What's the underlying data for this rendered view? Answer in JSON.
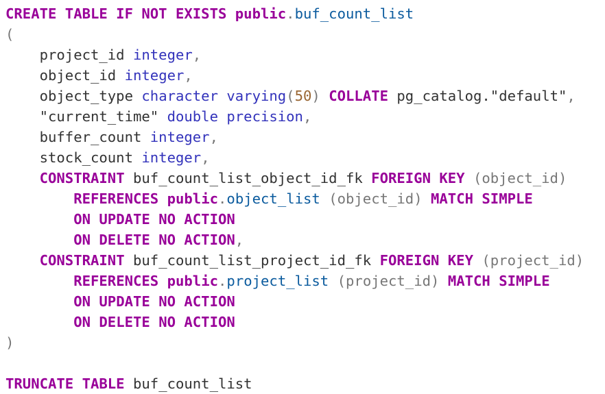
{
  "editor": {
    "lines": [
      [
        {
          "t": "CREATE TABLE IF NOT EXISTS ",
          "c": "kw"
        },
        {
          "t": "public",
          "c": "kw"
        },
        {
          "t": ".",
          "c": "punc"
        },
        {
          "t": "buf_count_list",
          "c": "obj"
        }
      ],
      [
        {
          "t": "(",
          "c": "punc"
        }
      ],
      [
        {
          "t": "    project_id ",
          "c": "id"
        },
        {
          "t": "integer",
          "c": "type"
        },
        {
          "t": ",",
          "c": "punc"
        }
      ],
      [
        {
          "t": "    object_id ",
          "c": "id"
        },
        {
          "t": "integer",
          "c": "type"
        },
        {
          "t": ",",
          "c": "punc"
        }
      ],
      [
        {
          "t": "    object_type ",
          "c": "id"
        },
        {
          "t": "character varying",
          "c": "type"
        },
        {
          "t": "(",
          "c": "punc"
        },
        {
          "t": "50",
          "c": "num"
        },
        {
          "t": ") ",
          "c": "punc"
        },
        {
          "t": "COLLATE",
          "c": "kw"
        },
        {
          "t": " pg_catalog.",
          "c": "id"
        },
        {
          "t": "\"default\"",
          "c": "str"
        },
        {
          "t": ",",
          "c": "punc"
        }
      ],
      [
        {
          "t": "    \"current_time\" ",
          "c": "str"
        },
        {
          "t": "double precision",
          "c": "type"
        },
        {
          "t": ",",
          "c": "punc"
        }
      ],
      [
        {
          "t": "    buffer_count ",
          "c": "id"
        },
        {
          "t": "integer",
          "c": "type"
        },
        {
          "t": ",",
          "c": "punc"
        }
      ],
      [
        {
          "t": "    stock_count ",
          "c": "id"
        },
        {
          "t": "integer",
          "c": "type"
        },
        {
          "t": ",",
          "c": "punc"
        }
      ],
      [
        {
          "t": "    ",
          "c": "id"
        },
        {
          "t": "CONSTRAINT",
          "c": "kw"
        },
        {
          "t": " buf_count_list_object_id_fk ",
          "c": "id"
        },
        {
          "t": "FOREIGN KEY",
          "c": "kw"
        },
        {
          "t": " (object_id)",
          "c": "punc"
        }
      ],
      [
        {
          "t": "        ",
          "c": "id"
        },
        {
          "t": "REFERENCES",
          "c": "kw"
        },
        {
          "t": " ",
          "c": "id"
        },
        {
          "t": "public",
          "c": "kw"
        },
        {
          "t": ".",
          "c": "punc"
        },
        {
          "t": "object_list",
          "c": "obj"
        },
        {
          "t": " (object_id) ",
          "c": "punc"
        },
        {
          "t": "MATCH SIMPLE",
          "c": "kw"
        }
      ],
      [
        {
          "t": "        ",
          "c": "id"
        },
        {
          "t": "ON UPDATE NO ACTION",
          "c": "kw"
        }
      ],
      [
        {
          "t": "        ",
          "c": "id"
        },
        {
          "t": "ON DELETE NO ACTION",
          "c": "kw"
        },
        {
          "t": ",",
          "c": "punc"
        }
      ],
      [
        {
          "t": "    ",
          "c": "id"
        },
        {
          "t": "CONSTRAINT",
          "c": "kw"
        },
        {
          "t": " buf_count_list_project_id_fk ",
          "c": "id"
        },
        {
          "t": "FOREIGN KEY",
          "c": "kw"
        },
        {
          "t": " (project_id)",
          "c": "punc"
        }
      ],
      [
        {
          "t": "        ",
          "c": "id"
        },
        {
          "t": "REFERENCES",
          "c": "kw"
        },
        {
          "t": " ",
          "c": "id"
        },
        {
          "t": "public",
          "c": "kw"
        },
        {
          "t": ".",
          "c": "punc"
        },
        {
          "t": "project_list",
          "c": "obj"
        },
        {
          "t": " (project_id) ",
          "c": "punc"
        },
        {
          "t": "MATCH SIMPLE",
          "c": "kw"
        }
      ],
      [
        {
          "t": "        ",
          "c": "id"
        },
        {
          "t": "ON UPDATE NO ACTION",
          "c": "kw"
        }
      ],
      [
        {
          "t": "        ",
          "c": "id"
        },
        {
          "t": "ON DELETE NO ACTION",
          "c": "kw"
        }
      ],
      [
        {
          "t": ")",
          "c": "punc"
        }
      ],
      [
        {
          "t": "",
          "c": "id"
        }
      ],
      [
        {
          "t": "TRUNCATE TABLE",
          "c": "kw"
        },
        {
          "t": " buf_count_list",
          "c": "id"
        }
      ]
    ]
  },
  "colors": {
    "keyword": "#990099",
    "type": "#3333bb",
    "number": "#996633",
    "object": "#0b5b9e",
    "punctuation": "#777777",
    "text": "#333333",
    "background": "#ffffff"
  }
}
